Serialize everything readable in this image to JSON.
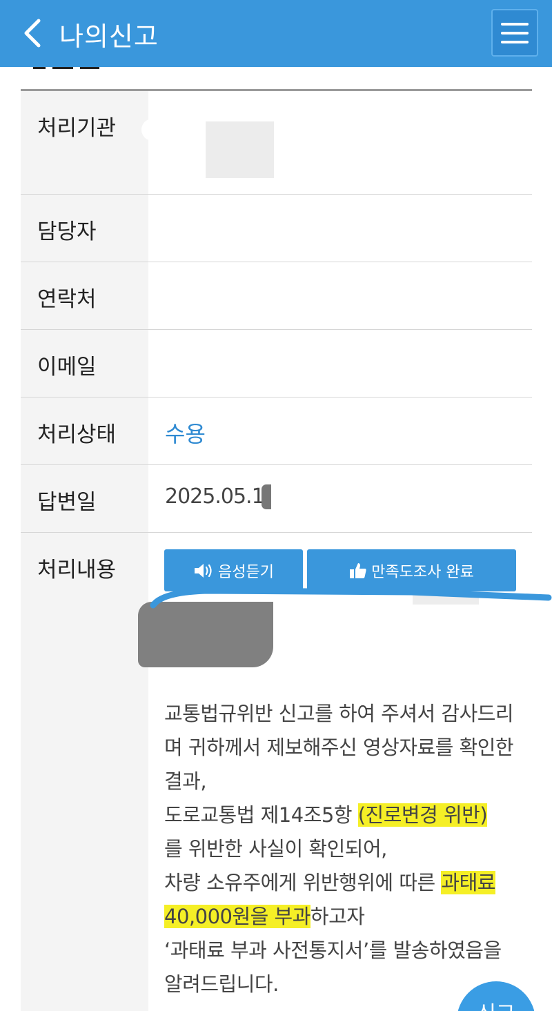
{
  "header": {
    "title": "나의신고"
  },
  "table": {
    "rows": {
      "agency": {
        "label": "처리기관",
        "value": ""
      },
      "manager": {
        "label": "담당자",
        "value": ""
      },
      "contact": {
        "label": "연락처",
        "value": ""
      },
      "email": {
        "label": "이메일",
        "value": ""
      },
      "status": {
        "label": "처리상태",
        "value": "수용"
      },
      "answer_date": {
        "label": "답변일",
        "value": "2025.05.1"
      },
      "content": {
        "label": "처리내용"
      }
    }
  },
  "buttons": {
    "voice": "음성듣기",
    "survey": "만족도조사 완료"
  },
  "content": {
    "line1": "교통법규위반 신고를 하여 주셔서 감사드리며 귀하께서 제보해주신 영상자료를 확인한 결과,",
    "line2_pre": "도로교통법 제14조5항 ",
    "line2_hl": "(진로변경 위반)",
    "line3": "를 위반한 사실이 확인되어,",
    "line4_pre": "차량 소유주에게 위반행위에 따른 ",
    "line4_hl": "과태료 40,000원을 부과",
    "line4_post": "하고자",
    "line5": "‘과태료 부과 사전통지서’를 발송하였음을 알려드립니다."
  },
  "fab": {
    "label": "신고"
  },
  "colors": {
    "header_bg": "#3a97dc",
    "accent": "#2f8ad2",
    "highlight": "#f5ef26"
  },
  "icons": {
    "back": "chevron-left-icon",
    "menu": "hamburger-menu-icon",
    "speaker": "speaker-icon",
    "thumbs_up": "thumbs-up-icon"
  }
}
